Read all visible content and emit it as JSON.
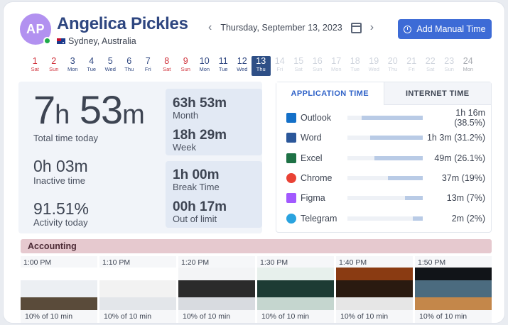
{
  "header": {
    "avatar_initials": "AP",
    "name": "Angelica Pickles",
    "location": "Sydney, Australia",
    "date": "Thursday, September 13, 2023",
    "add_button": "Add Manual Time",
    "prev_icon": "chevron-left-icon",
    "next_icon": "chevron-right-icon"
  },
  "days": [
    {
      "num": "1",
      "dow": "Sat",
      "kind": "wknd"
    },
    {
      "num": "2",
      "dow": "Sun",
      "kind": "wknd"
    },
    {
      "num": "3",
      "dow": "Mon",
      "kind": "wkday"
    },
    {
      "num": "4",
      "dow": "Tue",
      "kind": "wkday"
    },
    {
      "num": "5",
      "dow": "Wed",
      "kind": "wkday"
    },
    {
      "num": "6",
      "dow": "Thu",
      "kind": "wkday"
    },
    {
      "num": "7",
      "dow": "Fri",
      "kind": "wkday"
    },
    {
      "num": "8",
      "dow": "Sat",
      "kind": "wknd"
    },
    {
      "num": "9",
      "dow": "Sun",
      "kind": "wknd"
    },
    {
      "num": "10",
      "dow": "Mon",
      "kind": "wkday"
    },
    {
      "num": "11",
      "dow": "Tue",
      "kind": "wkday"
    },
    {
      "num": "12",
      "dow": "Wed",
      "kind": "wkday"
    },
    {
      "num": "13",
      "dow": "Thu",
      "kind": "active"
    },
    {
      "num": "14",
      "dow": "Fri",
      "kind": "future"
    },
    {
      "num": "15",
      "dow": "Sat",
      "kind": "future"
    },
    {
      "num": "16",
      "dow": "Sun",
      "kind": "future"
    },
    {
      "num": "17",
      "dow": "Mon",
      "kind": "future"
    },
    {
      "num": "18",
      "dow": "Tue",
      "kind": "future"
    },
    {
      "num": "19",
      "dow": "Wed",
      "kind": "future"
    },
    {
      "num": "20",
      "dow": "Thu",
      "kind": "future"
    },
    {
      "num": "21",
      "dow": "Fri",
      "kind": "future"
    },
    {
      "num": "22",
      "dow": "Sat",
      "kind": "future"
    },
    {
      "num": "23",
      "dow": "Sun",
      "kind": "future"
    },
    {
      "num": "24",
      "dow": "Mon",
      "kind": "ghost"
    }
  ],
  "stats": {
    "total_hours": "7",
    "total_minutes": "53",
    "h_unit": "h",
    "m_unit": "m",
    "total_label": "Total time today",
    "inactive_value": "0h 03m",
    "inactive_label": "Inactive time",
    "activity_value": "91.51%",
    "activity_label": "Activity today",
    "month_value": "63h 53m",
    "month_label": "Month",
    "week_value": "18h 29m",
    "week_label": "Week",
    "break_value": "1h 00m",
    "break_label": "Break Time",
    "limit_value": "00h 17m",
    "limit_label": "Out of limit"
  },
  "app_tabs": {
    "application": "APPLICATION TIME",
    "internet": "INTERNET TIME"
  },
  "apps": [
    {
      "name": "Outlook",
      "value": "1h 16m",
      "pct": "(38.5%)",
      "share": 0.808,
      "icon": "outlook-icon",
      "color": "#1470c8"
    },
    {
      "name": "Word",
      "value": "1h 3m",
      "pct": "(31.2%)",
      "share": 0.7,
      "icon": "word-icon",
      "color": "#2b579a"
    },
    {
      "name": "Excel",
      "value": "49m",
      "pct": "(26.1%)",
      "share": 0.64,
      "icon": "excel-icon",
      "color": "#1e7145"
    },
    {
      "name": "Chrome",
      "value": "37m",
      "pct": "(19%)",
      "share": 0.465,
      "icon": "chrome-icon",
      "color": "#e94235"
    },
    {
      "name": "Figma",
      "value": "13m",
      "pct": "(7%)",
      "share": 0.24,
      "icon": "figma-icon",
      "color": "#a259ff"
    },
    {
      "name": "Telegram",
      "value": "2m",
      "pct": "(2%)",
      "share": 0.13,
      "icon": "telegram-icon",
      "color": "#2aa3df"
    }
  ],
  "project": "Accounting",
  "screenshots": [
    {
      "time": "1:00 PM",
      "caption": "10% of 10 min"
    },
    {
      "time": "1:10 PM",
      "caption": "10% of 10 min"
    },
    {
      "time": "1:20 PM",
      "caption": "10% of 10 min"
    },
    {
      "time": "1:30 PM",
      "caption": "10% of 10 min"
    },
    {
      "time": "1:40 PM",
      "caption": "10% of 10 min"
    },
    {
      "time": "1:50 PM",
      "caption": "10% of 10 min"
    }
  ]
}
